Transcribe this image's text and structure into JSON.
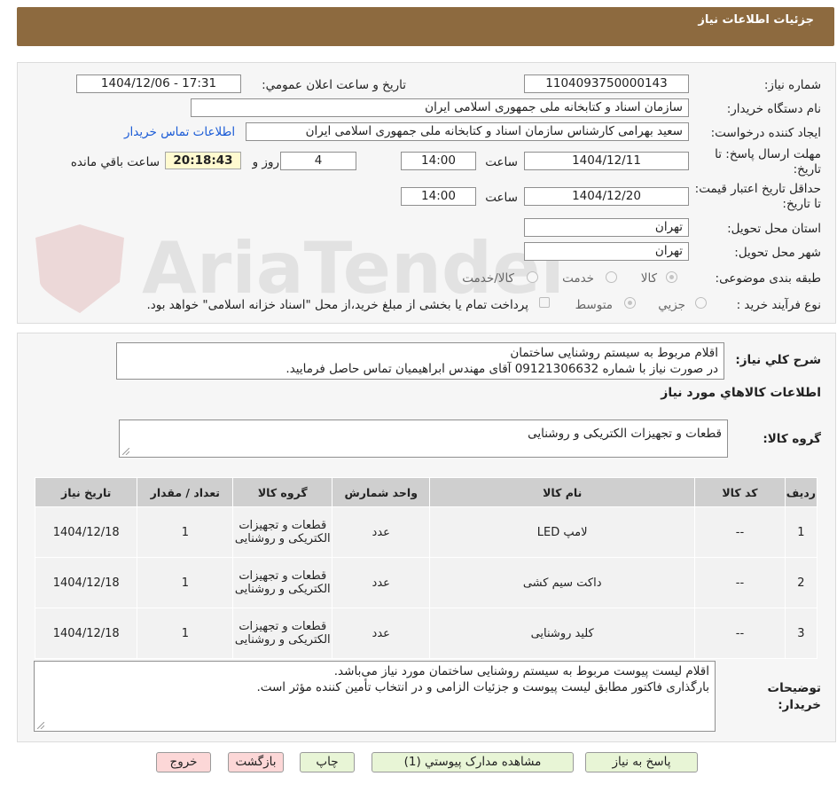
{
  "header": {
    "title": "جزئيات اطلاعات نياز"
  },
  "form": {
    "need_number_label": "شماره نياز:",
    "need_number": "1104093750000143",
    "announce_label": "تاريخ و ساعت اعلان عمومي:",
    "announce_value": "1404/12/06 - 17:31",
    "buyer_org_label": "نام دستگاه خريدار:",
    "buyer_org": "سازمان اسناد و کتابخانه ملی جمهوری اسلامی ایران",
    "creator_label": "ايجاد کننده درخواست:",
    "creator": "سعید بهرامی کارشناس سازمان اسناد و کتابخانه ملی جمهوری اسلامی ایران",
    "contact_link": "اطلاعات تماس خريدار",
    "reply_deadline_label": "مهلت ارسال پاسخ: تا تاريخ:",
    "reply_date": "1404/12/11",
    "time_label": "ساعت",
    "reply_time": "14:00",
    "days_value": "4",
    "days_label": "روز و",
    "timer": "20:18:43",
    "remaining_label": "ساعت باقي مانده",
    "validity_label": "حداقل تاريخ اعتبار قيمت: تا تاريخ:",
    "validity_date": "1404/12/20",
    "validity_time": "14:00",
    "province_label": "استان محل تحويل:",
    "province": "تهران",
    "city_label": "شهر محل تحويل:",
    "city": "تهران",
    "category_label": "طبقه بندی موضوعی:",
    "category_options": [
      "کالا",
      "خدمت",
      "کالا/خدمت"
    ],
    "process_label": "نوع فرآيند خريد :",
    "process_options": [
      "جزيي",
      "متوسط"
    ],
    "payment_note": "پرداخت تمام يا بخشی از مبلغ خريد،از محل \"اسناد خزانه اسلامی\" خواهد بود."
  },
  "watermark": {
    "text": "AriaTender.neT"
  },
  "description": {
    "label": "شرح کلي نياز:",
    "line1": "اقلام مربوط به سیستم روشنایی ساختمان",
    "line2": "در صورت نیاز با شماره 09121306632 آقای مهندس ابراهیمیان تماس حاصل فرمایید."
  },
  "goods": {
    "section_title": "اطلاعات کالاهاي مورد نياز",
    "group_label": "گروه کالا:",
    "group_value": "قطعات و تجهیزات الکتریکی و روشنایی"
  },
  "table": {
    "headers": [
      "رديف",
      "کد کالا",
      "نام کالا",
      "واحد شمارش",
      "گروه کالا",
      "تعداد / مقدار",
      "تاريخ نياز"
    ],
    "rows": [
      {
        "row": "1",
        "code": "--",
        "name": "لامپ LED",
        "unit": "عدد",
        "group": "قطعات و تجهیزات الکتریکی و روشنایی",
        "qty": "1",
        "date": "1404/12/18"
      },
      {
        "row": "2",
        "code": "--",
        "name": "داکت سیم کشی",
        "unit": "عدد",
        "group": "قطعات و تجهیزات الکتریکی و روشنایی",
        "qty": "1",
        "date": "1404/12/18"
      },
      {
        "row": "3",
        "code": "--",
        "name": "کلید روشنایی",
        "unit": "عدد",
        "group": "قطعات و تجهیزات الکتریکی و روشنایی",
        "qty": "1",
        "date": "1404/12/18"
      }
    ]
  },
  "buyer_notes": {
    "label": "توضيحات خريدار:",
    "line1": "اقلام لیست پیوست مربوط به سیستم روشنایی ساختمان مورد نیاز می‌باشد.",
    "line2": "بارگذاری فاکتور مطابق لیست پیوست و جزئیات الزامی و در انتخاب تأمین کننده مؤثر است."
  },
  "buttons": {
    "reply": "پاسخ به نياز",
    "docs": "مشاهده مدارک پيوستي (1)",
    "print": "چاپ",
    "back": "بازگشت",
    "exit": "خروج"
  },
  "colors": {
    "header_bg": "#8d6a3f",
    "green_button": "#e8f5d6",
    "pink_button": "#fcd7d7",
    "timer_bg": "#fffad0",
    "link": "#1a5bd6"
  }
}
